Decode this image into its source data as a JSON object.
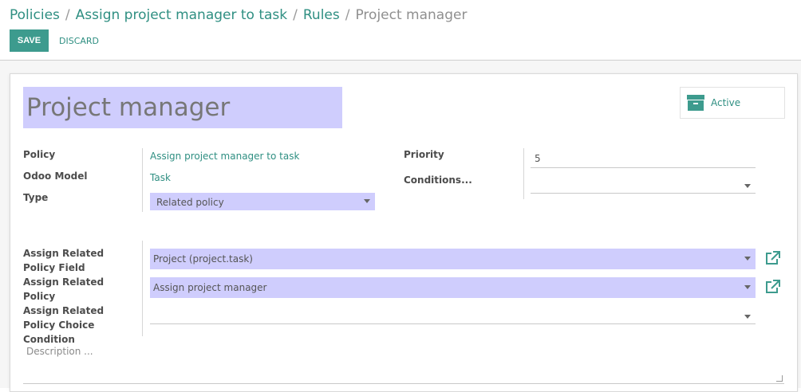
{
  "breadcrumb": {
    "items": [
      "Policies",
      "Assign project manager to task",
      "Rules"
    ],
    "current": "Project manager",
    "separator": "/"
  },
  "toolbar": {
    "save_label": "SAVE",
    "discard_label": "DISCARD"
  },
  "record": {
    "title": "Project manager",
    "active_label": "Active"
  },
  "fields": {
    "policy_label": "Policy",
    "policy_value": "Assign project manager to task",
    "model_label": "Odoo Model",
    "model_value": "Task",
    "type_label": "Type",
    "type_value": "Related policy",
    "priority_label": "Priority",
    "priority_value": "5",
    "conditions_label": "Conditions...",
    "conditions_value": "",
    "related_field_label": "Assign Related Policy Field",
    "related_field_value": "Project (project.task)",
    "related_policy_label": "Assign Related Policy",
    "related_policy_value": "Assign project manager",
    "choice_condition_label": "Assign Related Policy Choice Condition",
    "choice_condition_value": "",
    "description_placeholder": "Description ..."
  },
  "colors": {
    "accent": "#3d9b8e",
    "link": "#2f8f82",
    "required_bg": "#cfcdfd"
  },
  "icons": {
    "archive": "archive-icon",
    "external_link": "external-link-icon",
    "dropdown": "caret-down-icon"
  }
}
